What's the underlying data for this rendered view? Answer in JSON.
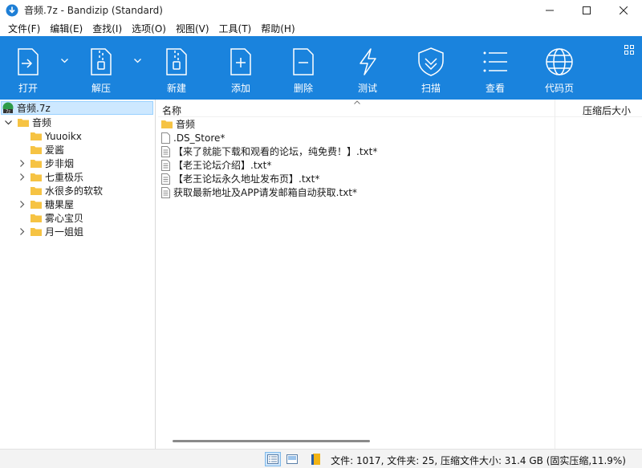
{
  "window": {
    "title": "音频.7z - Bandizip (Standard)",
    "accent": "#1a83dd"
  },
  "menu": [
    "文件(F)",
    "编辑(E)",
    "查找(I)",
    "选项(O)",
    "视图(V)",
    "工具(T)",
    "帮助(H)"
  ],
  "toolbar": {
    "open": "打开",
    "extract": "解压",
    "new": "新建",
    "add": "添加",
    "delete": "删除",
    "test": "测试",
    "scan": "扫描",
    "view": "查看",
    "codepage": "代码页"
  },
  "tree": {
    "root": "音频.7z",
    "folder": "音频",
    "children": [
      "Yuuoikx",
      "爱酱",
      "步非烟",
      "七重极乐",
      "水很多的软软",
      "糖果屋",
      "雾心宝贝",
      "月一姐姐"
    ]
  },
  "columns": {
    "name": "名称",
    "compressed_size": "压缩后大小"
  },
  "files": [
    "音频",
    ".DS_Store*",
    "【来了就能下载和观看的论坛，纯免费！】.txt*",
    "【老王论坛介绍】.txt*",
    "【老王论坛永久地址发布页】.txt*",
    "获取最新地址及APP请发邮箱自动获取.txt*"
  ],
  "status": {
    "summary": "文件: 1017, 文件夹: 25, 压缩文件大小: 31.4 GB (固实压缩,11.9%)"
  },
  "icons": {
    "folder_color": "#f6c343"
  }
}
